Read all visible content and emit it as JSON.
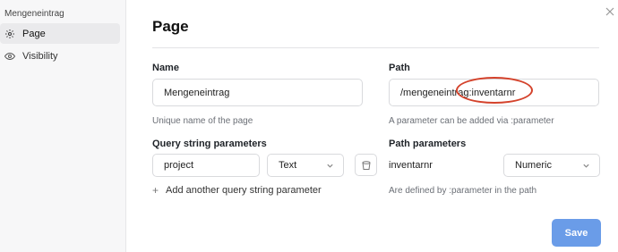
{
  "sidebar": {
    "title": "Mengeneintrag",
    "items": [
      {
        "label": "Page",
        "icon": "gear-icon",
        "active": true
      },
      {
        "label": "Visibility",
        "icon": "eye-icon",
        "active": false
      }
    ]
  },
  "page": {
    "title": "Page"
  },
  "name": {
    "label": "Name",
    "value": "Mengeneintrag",
    "hint": "Unique name of the page"
  },
  "path": {
    "label": "Path",
    "value": "/mengeneintrag:inventarnr",
    "hint": "A parameter can be added via :parameter"
  },
  "query": {
    "label": "Query string parameters",
    "param_value": "project",
    "type_value": "Text",
    "add_label": "Add another query string parameter"
  },
  "path_params": {
    "label": "Path parameters",
    "param_name": "inventarnr",
    "type_value": "Numeric",
    "hint": "Are defined by :parameter in the path"
  },
  "actions": {
    "save_label": "Save"
  },
  "colors": {
    "accent": "#6a9ce8",
    "annotation": "#d4422b"
  }
}
